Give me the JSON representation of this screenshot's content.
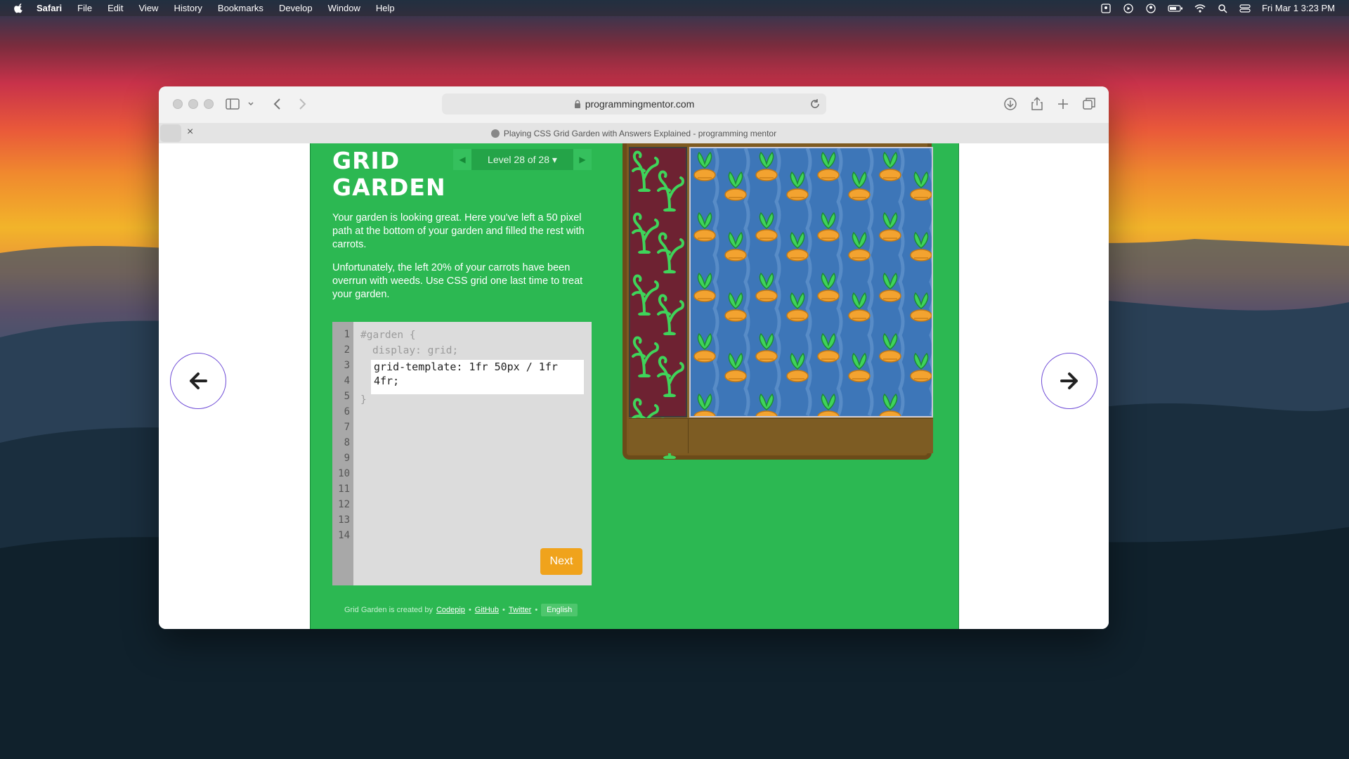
{
  "menubar": {
    "app": "Safari",
    "items": [
      "File",
      "Edit",
      "View",
      "History",
      "Bookmarks",
      "Develop",
      "Window",
      "Help"
    ],
    "datetime": "Fri Mar 1  3:23 PM"
  },
  "browser": {
    "url": "programmingmentor.com",
    "tab_title": "Playing CSS Grid Garden with Answers Explained - programming mentor"
  },
  "game": {
    "title_line1": "GRID",
    "title_line2": "GARDEN",
    "level_label": "Level 28 of 28",
    "instructions": [
      "Your garden is looking great. Here you've left a 50 pixel path at the bottom of your garden and filled the rest with carrots.",
      "Unfortunately, the left 20% of your carrots have been overrun with weeds. Use CSS grid one last time to treat your garden."
    ],
    "editor": {
      "line_numbers": [
        "1",
        "2",
        "3",
        "4",
        "5",
        "6",
        "7",
        "8",
        "9",
        "10",
        "11",
        "12",
        "13",
        "14"
      ],
      "line1": "#garden {",
      "line2": "display: grid;",
      "line5": "}",
      "input_value": "grid-template: 1fr 50px / 1fr 4fr;"
    },
    "next_label": "Next",
    "footer": {
      "prefix": "Grid Garden is created by",
      "codepip": "Codepip",
      "github": "GitHub",
      "twitter": "Twitter",
      "sep": "•",
      "language": "English"
    }
  },
  "colors": {
    "game_green": "#2cb852",
    "next_orange": "#f0a31c",
    "nav_ring": "#6e4bd6"
  }
}
